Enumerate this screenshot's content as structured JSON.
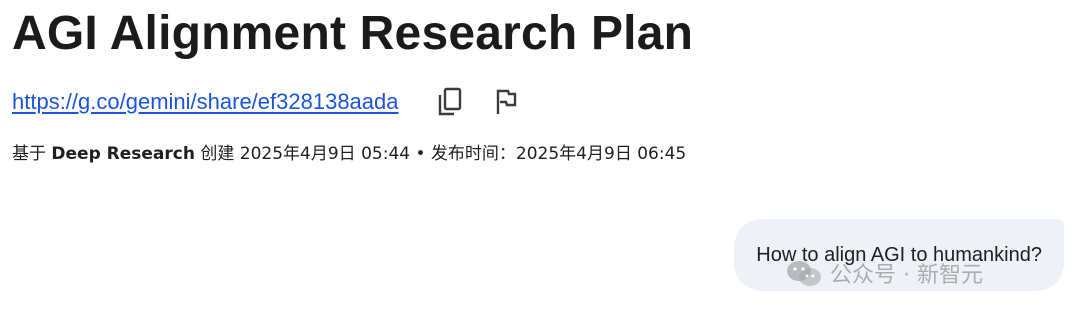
{
  "page": {
    "title": "AGI Alignment Research Plan",
    "share_link": "https://g.co/gemini/share/ef328138aada"
  },
  "meta": {
    "prefix": "基于 ",
    "tool": "Deep Research",
    "created_label": " 创建 ",
    "created_date": "2025年4月9日 05:44",
    "separator": " • ",
    "published_label": "发布时间：",
    "published_date": "2025年4月9日 06:45"
  },
  "actions": {
    "copy_icon": "copy-icon",
    "flag_icon": "flag-icon"
  },
  "chat": {
    "user_message": "How to align AGI to humankind?"
  },
  "watermark": {
    "text": "公众号 · 新智元",
    "icon": "wechat-icon"
  },
  "colors": {
    "link": "#1a56db",
    "bubble_bg": "#eef1f8",
    "text": "#1f1f1f"
  }
}
